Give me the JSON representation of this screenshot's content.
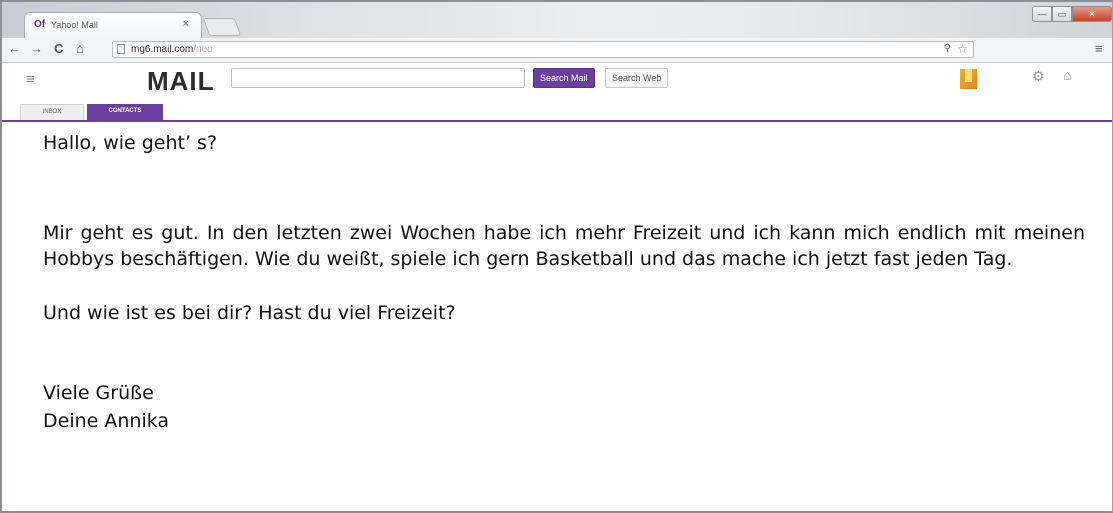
{
  "browser": {
    "tab_title": "Yahoo! Mail",
    "tab_favicon": "Of",
    "tab_close": "×",
    "url_host": "mg6.mail.com",
    "url_path": "/neo",
    "nav": {
      "back": "←",
      "forward": "→",
      "reload": "C",
      "home": "⌂"
    },
    "window": {
      "minimize": "—",
      "maximize": "▭",
      "close": "✕"
    },
    "icons": {
      "zoom": "zoom-icon",
      "star": "star-icon",
      "menu": "menu-icon"
    }
  },
  "mail": {
    "logo": "MAIL",
    "search_value": "",
    "search_mail_label": "Search Mail",
    "search_web_label": "Search Web",
    "tabs": [
      {
        "label": "INBOX"
      },
      {
        "label": "CONTACTS"
      }
    ],
    "accent_color": "#6b3fa0"
  },
  "message": {
    "greeting": "Hallo, wie geht’ s?",
    "body": "Mir geht es gut. In den letzten zwei Wochen habe ich mehr Freizeit und ich kann mich endlich mit meinen Hobbys beschäftigen. Wie du weißt, spiele ich gern Basketball und das mache ich jetzt fast jeden Tag.",
    "question": "Und wie ist es bei dir? Hast du viel Freizeit?",
    "closing": "Viele Grüße",
    "signature": "Deine Annika"
  }
}
